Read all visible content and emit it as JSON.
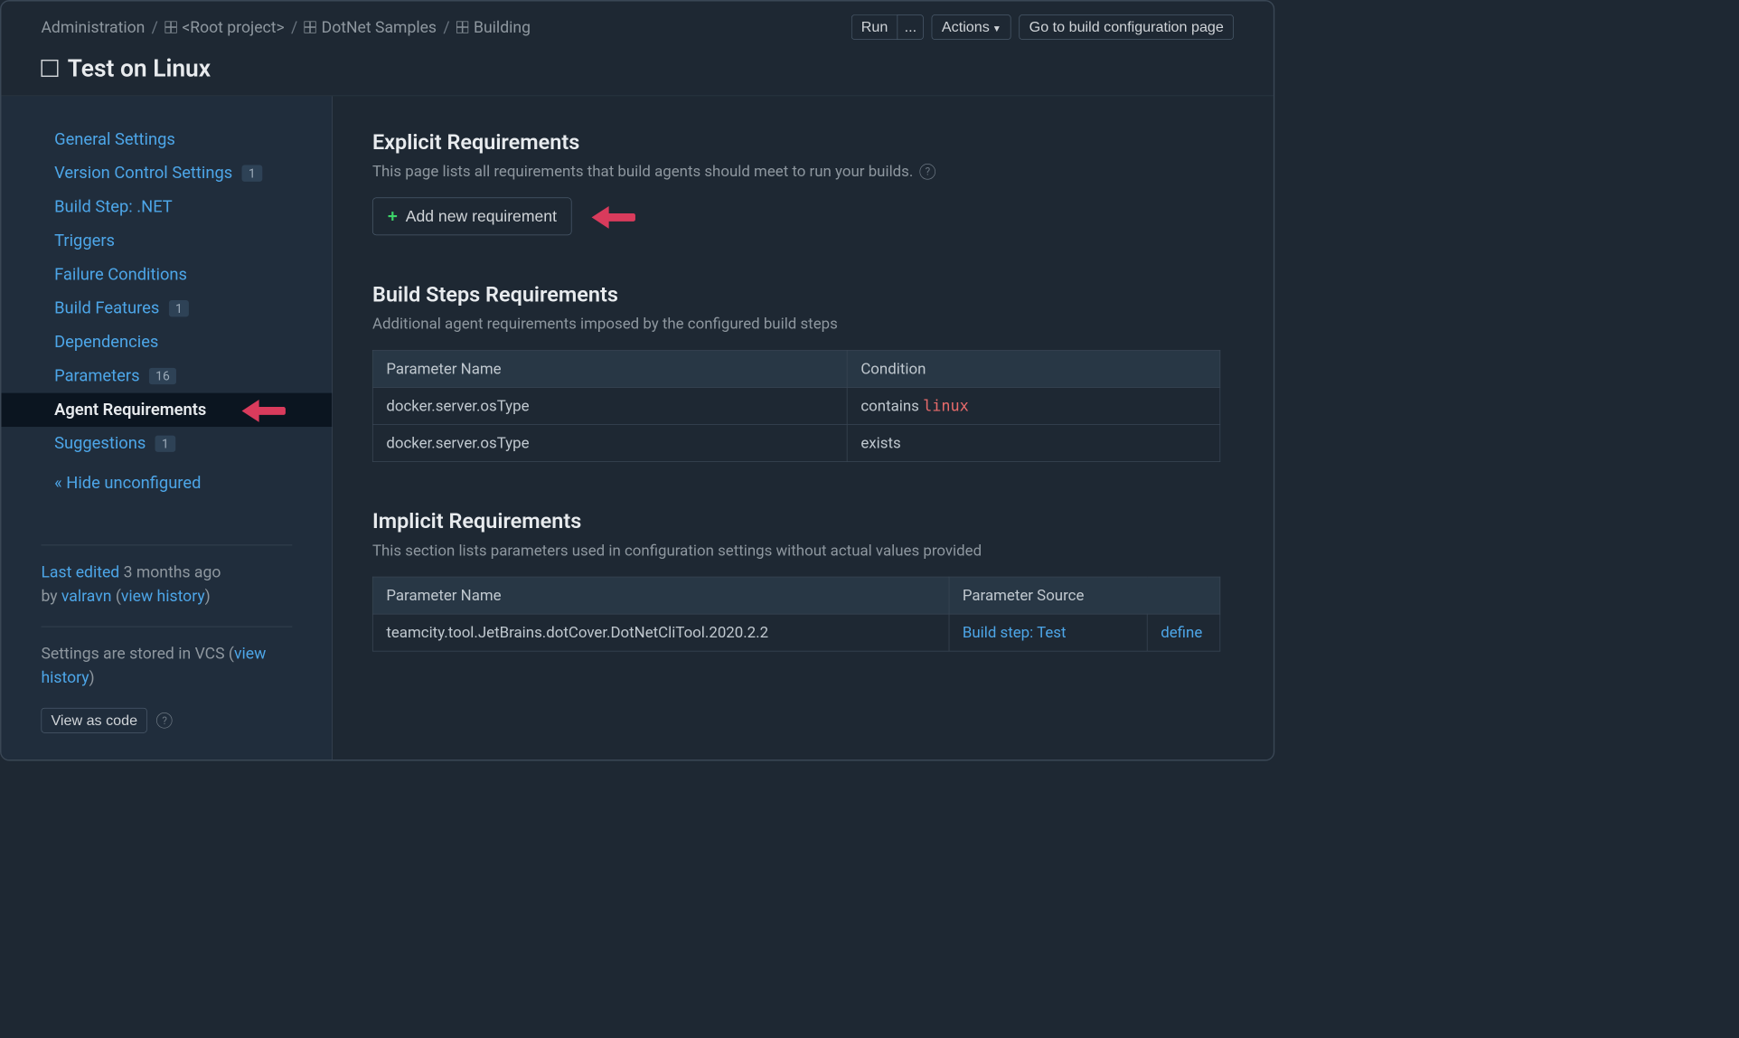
{
  "breadcrumb": {
    "admin": "Administration",
    "root": "<Root project>",
    "project": "DotNet Samples",
    "build": "Building"
  },
  "header_buttons": {
    "run": "Run",
    "run_more": "...",
    "actions": "Actions",
    "goto": "Go to build configuration page"
  },
  "page_title": "Test on Linux",
  "sidebar": {
    "items": [
      {
        "label": "General Settings"
      },
      {
        "label": "Version Control Settings",
        "badge": "1"
      },
      {
        "label": "Build Step: .NET"
      },
      {
        "label": "Triggers"
      },
      {
        "label": "Failure Conditions"
      },
      {
        "label": "Build Features",
        "badge": "1"
      },
      {
        "label": "Dependencies"
      },
      {
        "label": "Parameters",
        "badge": "16"
      },
      {
        "label": "Agent Requirements"
      },
      {
        "label": "Suggestions",
        "badge": "1"
      }
    ],
    "hide_unconfigured": "« Hide unconfigured"
  },
  "meta": {
    "last_edited_prefix": "Last edited",
    "last_edited_time": "3 months ago",
    "by": "by",
    "user": "valravn",
    "view_history": "view history",
    "vcs_prefix": "Settings are stored in VCS (",
    "vcs_link": "view history",
    "vcs_suffix": ")",
    "view_as_code": "View as code"
  },
  "explicit": {
    "title": "Explicit Requirements",
    "subtitle": "This page lists all requirements that build agents should meet to run your builds.",
    "add_button": "Add new requirement"
  },
  "buildsteps": {
    "title": "Build Steps Requirements",
    "subtitle": "Additional agent requirements imposed by the configured build steps",
    "col_param": "Parameter Name",
    "col_cond": "Condition",
    "rows": [
      {
        "param": "docker.server.osType",
        "cond_prefix": "contains",
        "cond_val": "linux"
      },
      {
        "param": "docker.server.osType",
        "cond_prefix": "exists",
        "cond_val": ""
      }
    ]
  },
  "implicit": {
    "title": "Implicit Requirements",
    "subtitle": "This section lists parameters used in configuration settings without actual values provided",
    "col_param": "Parameter Name",
    "col_src": "Parameter Source",
    "rows": [
      {
        "param": "teamcity.tool.JetBrains.dotCover.DotNetCliTool.2020.2.2",
        "src": "Build step: Test",
        "define": "define"
      }
    ]
  }
}
